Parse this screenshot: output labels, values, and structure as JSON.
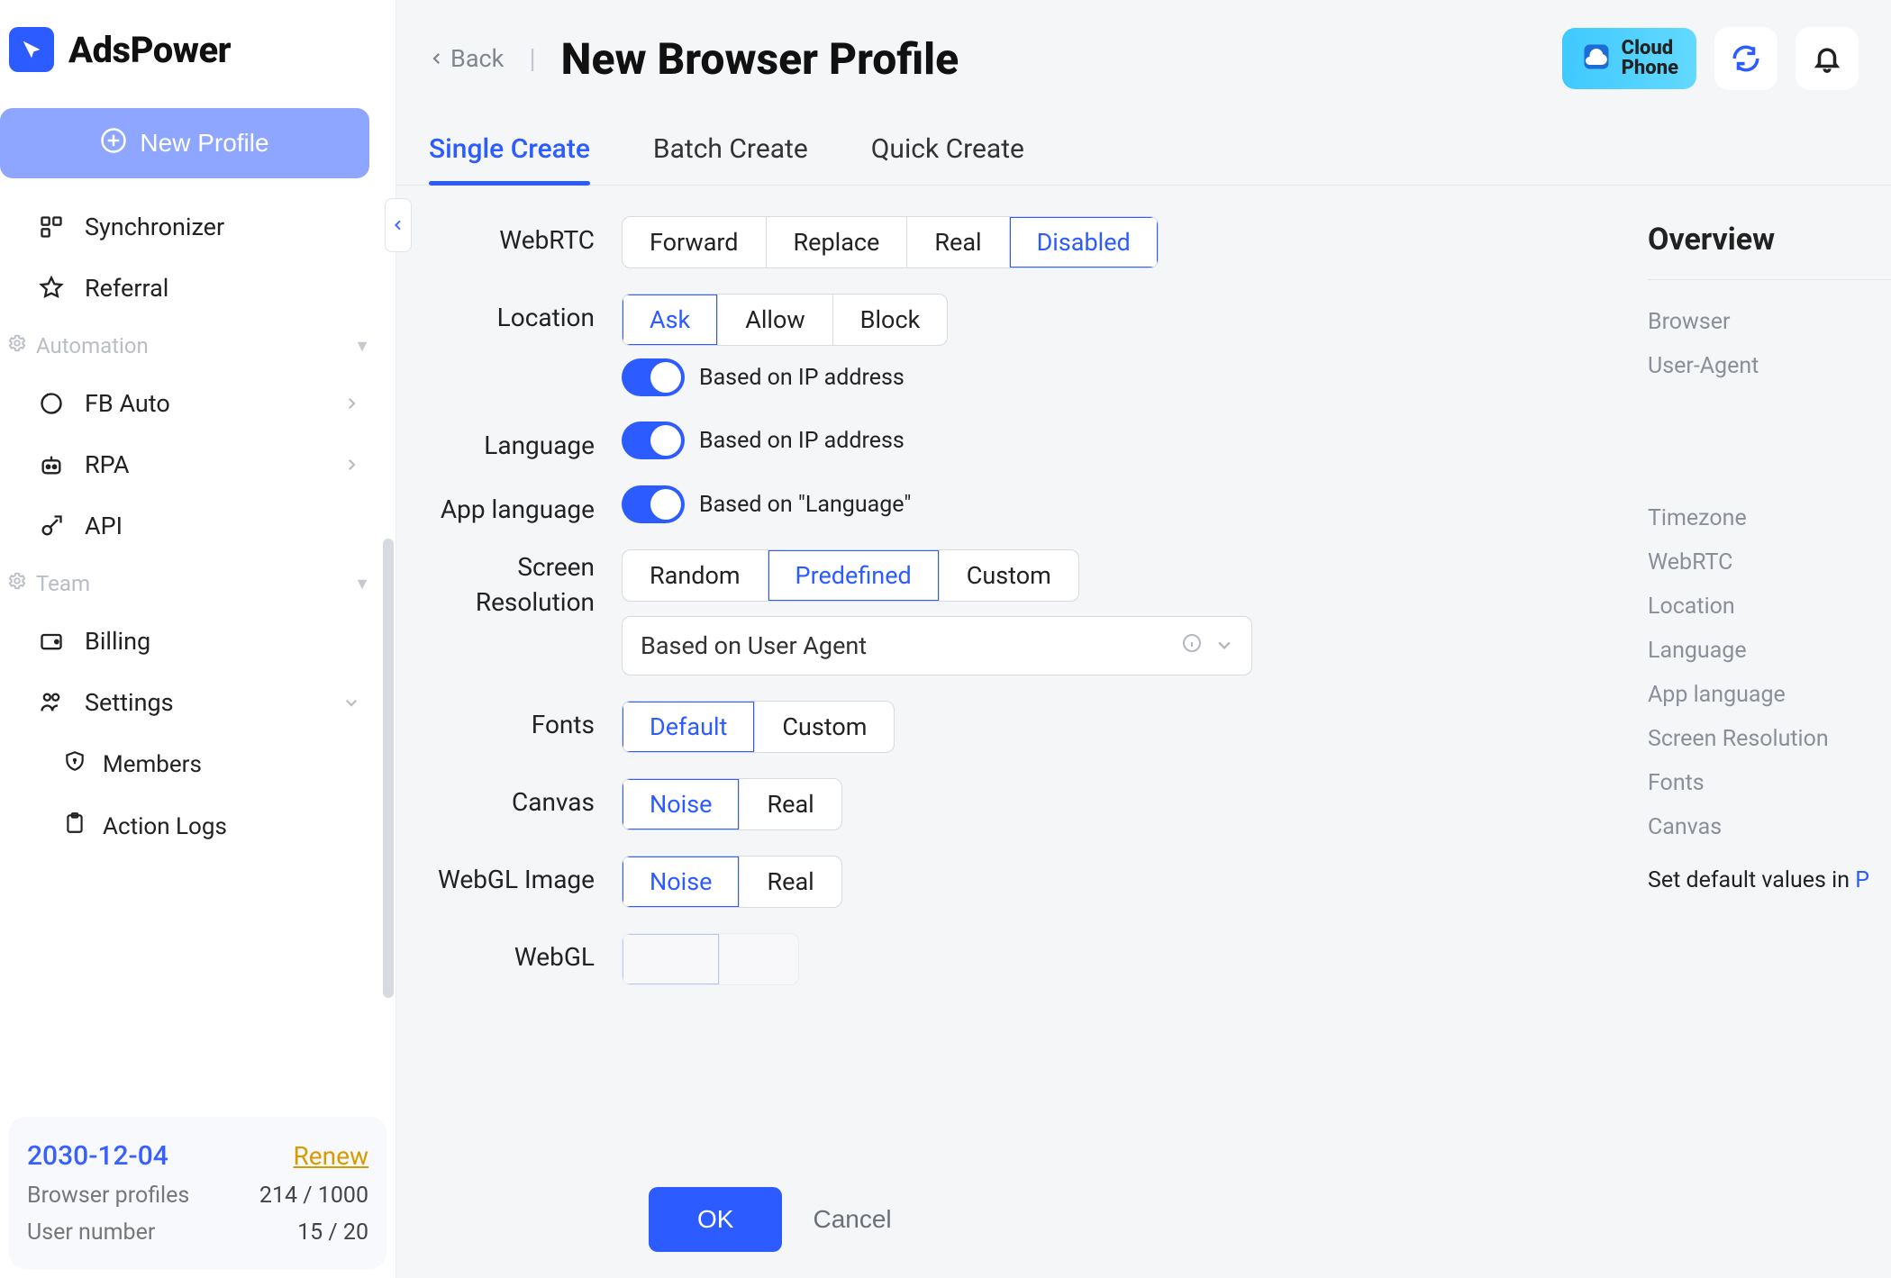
{
  "brand": "AdsPower",
  "sidebar": {
    "new_profile_label": "New Profile",
    "items": {
      "synchronizer": "Synchronizer",
      "referral": "Referral"
    },
    "sections": {
      "automation": {
        "label": "Automation",
        "fb_auto": "FB Auto",
        "rpa": "RPA",
        "api": "API"
      },
      "team": {
        "label": "Team",
        "billing": "Billing",
        "settings": "Settings",
        "members": "Members",
        "action_logs": "Action Logs"
      }
    },
    "footer": {
      "date": "2030-12-04",
      "renew": "Renew",
      "profiles_label": "Browser profiles",
      "profiles_value": "214 / 1000",
      "users_label": "User number",
      "users_value": "15 / 20"
    }
  },
  "header": {
    "back": "Back",
    "title": "New Browser Profile",
    "cloud_line1": "Cloud",
    "cloud_line2": "Phone"
  },
  "tabs": {
    "single": "Single Create",
    "batch": "Batch Create",
    "quick": "Quick Create"
  },
  "form": {
    "webrtc": {
      "label": "WebRTC",
      "opts": {
        "forward": "Forward",
        "replace": "Replace",
        "real": "Real",
        "disabled": "Disabled"
      }
    },
    "location": {
      "label": "Location",
      "opts": {
        "ask": "Ask",
        "allow": "Allow",
        "block": "Block"
      },
      "hint": "Based on IP address"
    },
    "language": {
      "label": "Language",
      "hint": "Based on IP address"
    },
    "app_language": {
      "label": "App language",
      "hint": "Based on \"Language\""
    },
    "screenres": {
      "label": "Screen Resolution",
      "opts": {
        "random": "Random",
        "predefined": "Predefined",
        "custom": "Custom"
      },
      "select_value": "Based on User Agent"
    },
    "fonts": {
      "label": "Fonts",
      "opts": {
        "default": "Default",
        "custom": "Custom"
      }
    },
    "canvas": {
      "label": "Canvas",
      "opts": {
        "noise": "Noise",
        "real": "Real"
      }
    },
    "webgl_image": {
      "label": "WebGL Image",
      "opts": {
        "noise": "Noise",
        "real": "Real"
      }
    },
    "webgl": {
      "label": "WebGL"
    }
  },
  "overview": {
    "heading": "Overview",
    "items": {
      "browser": "Browser",
      "user_agent": "User-Agent",
      "timezone": "Timezone",
      "webrtc": "WebRTC",
      "location": "Location",
      "language": "Language",
      "app_language": "App language",
      "screenres": "Screen Resolution",
      "fonts": "Fonts",
      "canvas": "Canvas"
    },
    "footer_text": "Set default values in ",
    "footer_link": "P"
  },
  "actions": {
    "ok": "OK",
    "cancel": "Cancel"
  }
}
